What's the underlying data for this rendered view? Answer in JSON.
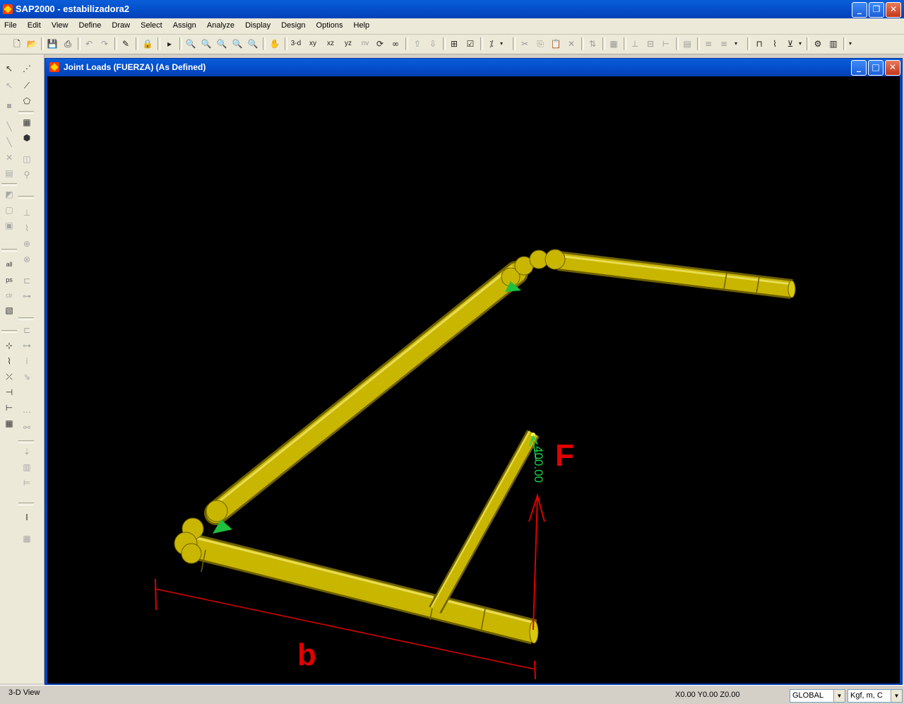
{
  "app": {
    "title": "SAP2000 - estabilizadora2"
  },
  "menu": [
    "File",
    "Edit",
    "View",
    "Define",
    "Draw",
    "Select",
    "Assign",
    "Analyze",
    "Display",
    "Design",
    "Options",
    "Help"
  ],
  "toolbar": {
    "view_3d": "3-d",
    "view_xy": "xy",
    "view_xz": "xz",
    "view_yz": "yz",
    "view_nv": "nv"
  },
  "leftbar": {
    "all_label": "all",
    "ps_label": "ps",
    "clr_label": "clr"
  },
  "child_window": {
    "title": "Joint Loads (FUERZA) (As Defined)"
  },
  "viewport": {
    "load_value": "400.00",
    "annotation_force": "F",
    "annotation_length": "b",
    "colors": {
      "member": "#c8b400",
      "support": "#1fbf3f",
      "load": "#19d34a",
      "annotation": "#e00000"
    }
  },
  "status": {
    "view_label": "3-D View",
    "coords": "X0.00  Y0.00  Z0.00",
    "coord_system": "GLOBAL",
    "units": "Kgf, m, C"
  }
}
